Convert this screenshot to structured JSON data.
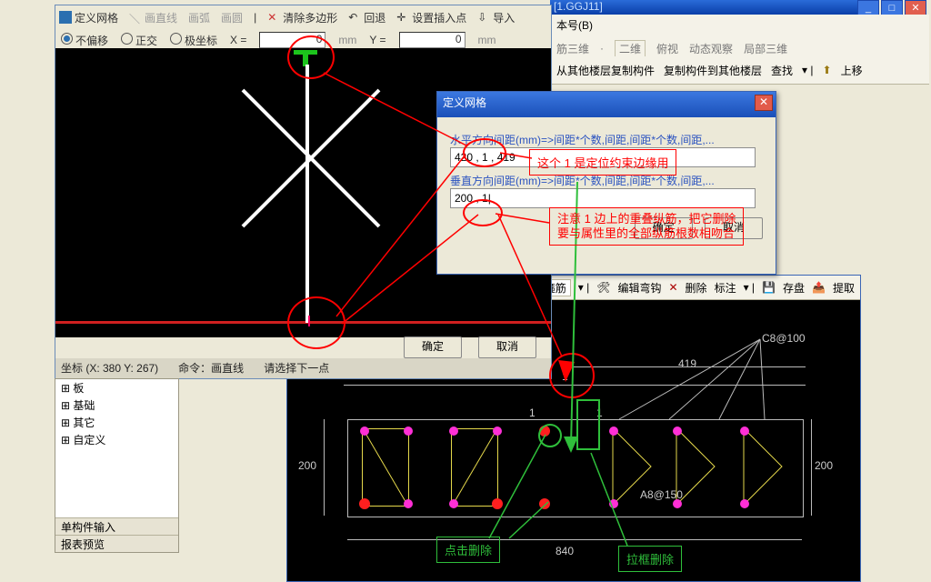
{
  "window": {
    "title_fragment": "[1.GGJ11]",
    "btn_min": "_",
    "btn_max": "□",
    "btn_close": "✕"
  },
  "panelA": {
    "tb": {
      "define_grid": "定义网格",
      "draw_line": "画直线",
      "draw_arc": "画弧",
      "draw_circle": "画圆",
      "clear_poly": "清除多边形",
      "undo": "回退",
      "set_insert": "设置插入点",
      "import": "导入"
    },
    "offset": {
      "no_offset": "不偏移",
      "ortho": "正交",
      "polar": "极坐标",
      "x_label": "X =",
      "x_val": "0",
      "y_label": "Y =",
      "y_val": "0",
      "unit": "mm"
    },
    "btn_ok": "确定",
    "btn_cancel": "取消",
    "status": {
      "coord": "坐标 (X: 380 Y: 267)",
      "cmd": "命令：画直线",
      "prompt": "请选择下一点"
    }
  },
  "dialogB": {
    "title": "定义网格",
    "label_h": "水平方向间距(mm)=>间距*个数,间距,间距*个数,间距,...",
    "value_h": "420 , 1 , 419",
    "label_v": "垂直方向间距(mm)=>间距*个数,间距,间距*个数,间距,...",
    "value_v": "200 , 1|",
    "btn_ok": "确定",
    "btn_cancel": "取消"
  },
  "right_tb": {
    "version": "本号(B)",
    "sanwei": "筋三维",
    "erwei": "二维",
    "fushi": "俯视",
    "dongtai": "动态观察",
    "jubu": "局部三维",
    "copy_from": "从其他楼层复制构件",
    "copy_to": "复制构件到其他楼层",
    "find": "查找",
    "up": "上移"
  },
  "vpB_tb": {
    "set_stirrup": "置箍筋",
    "edit_hook": "编辑弯钩",
    "delete": "删除",
    "annotate": "标注",
    "save": "存盘",
    "extract": "提取"
  },
  "tree": {
    "n1": "板",
    "n2": "基础",
    "n3": "其它",
    "n4": "自定义",
    "foot1": "单构件输入",
    "foot2": "报表预览"
  },
  "annotations": {
    "a1": "这个 1 是定位约束边缘用",
    "a2_l1": "注意 1 边上的重叠纵筋，把它删除",
    "a2_l2": "要与属性里的全部纵筋根数相吻合",
    "a3": "点击删除",
    "a4": "拉框删除"
  },
  "dims": {
    "d1": "1",
    "d419": "419",
    "d200l": "200",
    "d200r": "200",
    "d840": "840",
    "c8_100": "C8@100",
    "a8_150": "A8@150",
    "d1b": "1",
    "d1c": "1"
  },
  "chart_data": {
    "type": "table",
    "note": "numeric dimensions displayed in the CAD section view",
    "horizontal_spacing_mm": [
      420,
      1,
      419
    ],
    "vertical_spacing_mm": [
      200,
      1
    ],
    "section_width_mm": 840,
    "section_height_mm": 200,
    "stirrups": [
      "C8@100",
      "A8@150"
    ]
  }
}
